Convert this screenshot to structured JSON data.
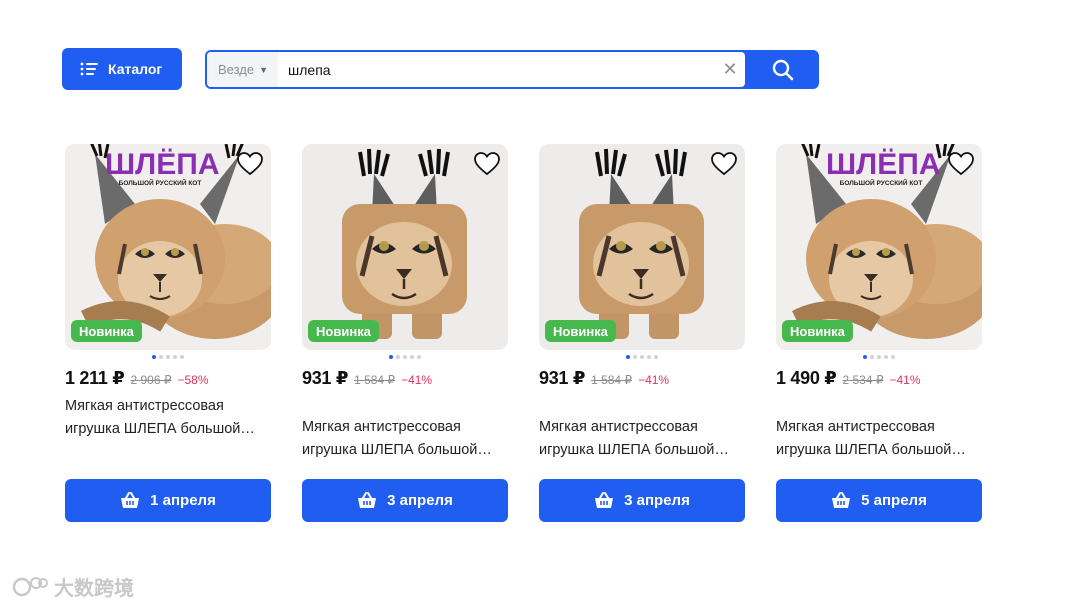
{
  "header": {
    "catalog_label": "Каталог",
    "search": {
      "scope": "Везде",
      "query": "шлепа"
    }
  },
  "colors": {
    "accent": "#1f5ef0",
    "badge": "#47b84e",
    "discount": "#e0335a"
  },
  "products": [
    {
      "badge": "Новинка",
      "price": "1 211 ₽",
      "old_price": "2 906 ₽",
      "discount": "−58%",
      "title": "Мягкая антистрессовая игрушка ШЛЕПА большой…",
      "delivery": "1 апреля",
      "photo_caption": "ШЛЁПА",
      "photo_subcaption": "БОЛЬШОЙ РУССКИЙ КОТ"
    },
    {
      "badge": "Новинка",
      "price": "931 ₽",
      "old_price": "1 584 ₽",
      "discount": "−41%",
      "title": "Мягкая антистрессовая игрушка ШЛЕПА большой…",
      "delivery": "3 апреля"
    },
    {
      "badge": "Новинка",
      "price": "931 ₽",
      "old_price": "1 584 ₽",
      "discount": "−41%",
      "title": "Мягкая антистрессовая игрушка ШЛЕПА большой…",
      "delivery": "3 апреля"
    },
    {
      "badge": "Новинка",
      "price": "1 490 ₽",
      "old_price": "2 534 ₽",
      "discount": "−41%",
      "title": "Мягкая антистрессовая игрушка ШЛЕПА большой…",
      "delivery": "5 апреля",
      "photo_caption": "ШЛЁПА",
      "photo_subcaption": "БОЛЬШОЙ РУССКИЙ КОТ"
    }
  ],
  "watermark": "大数跨境"
}
